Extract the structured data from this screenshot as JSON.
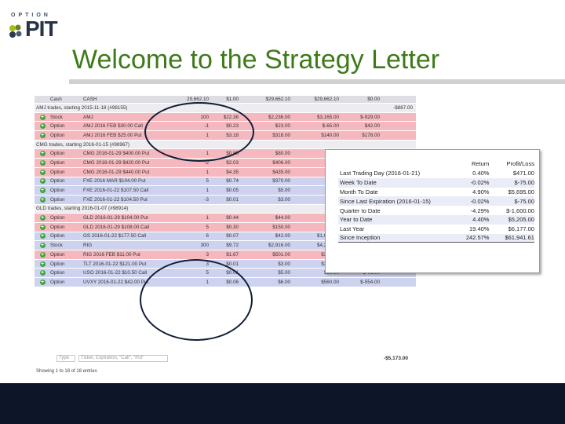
{
  "logo": {
    "top_word": "OPTION",
    "main_word": "PIT"
  },
  "title": "Welcome to the Strategy Letter",
  "positions": {
    "header": {
      "type": "Cash",
      "security": "CASH",
      "qty": "29,662.10",
      "price": "$1.00",
      "cost": "$29,662.10",
      "market": "$29,662.10",
      "pl": "$0.00"
    },
    "rows": [
      {
        "kind": "group",
        "label": "AMJ trades, starting 2015-11-18 (#98155)",
        "pl": "-$887.00",
        "tone": "pos"
      },
      {
        "kind": "pos",
        "type": "Stock",
        "security": "AMJ",
        "qty": "100",
        "price": "$22.36",
        "cost": "$2,236.00",
        "market": "$3,165.00",
        "pl": "$-929.00",
        "tone": "pos"
      },
      {
        "kind": "pos",
        "type": "Option",
        "security": "AMJ 2016 FEB $30.00 Call",
        "qty": "-1",
        "price": "$0.23",
        "cost": "$23.00",
        "market": "$-65.00",
        "pl": "$42.00",
        "tone": "pos"
      },
      {
        "kind": "pos",
        "type": "Option",
        "security": "AMJ 2016 FEB $25.00 Put",
        "qty": "1",
        "price": "$3.18",
        "cost": "$318.00",
        "market": "$140.00",
        "pl": "$178.00",
        "tone": "pos"
      },
      {
        "kind": "group",
        "label": "CMG trades, starting 2016-01-15 (#98967)",
        "pl": "",
        "tone": "neu"
      },
      {
        "kind": "pos",
        "type": "Option",
        "security": "CMG 2016-01-29 $400.00 Put",
        "qty": "1",
        "price": "$0.80",
        "cost": "$80.00",
        "market": "",
        "pl": "",
        "tone": "pos"
      },
      {
        "kind": "pos",
        "type": "Option",
        "security": "CMG 2016-01-29 $420.00 Put",
        "qty": "-2",
        "price": "$2.03",
        "cost": "$406.00",
        "market": "",
        "pl": "",
        "tone": "pos"
      },
      {
        "kind": "pos",
        "type": "Option",
        "security": "CMG 2016-01-29 $440.00 Put",
        "qty": "1",
        "price": "$4.35",
        "cost": "$435.00",
        "market": "",
        "pl": "",
        "tone": "pos"
      },
      {
        "kind": "pos",
        "type": "Option",
        "security": "FXE 2016 MAR $104.00 Put",
        "qty": "5",
        "price": "$0.74",
        "cost": "$370.00",
        "market": "",
        "pl": "",
        "tone": "neg"
      },
      {
        "kind": "pos",
        "type": "Option",
        "security": "FXE 2016-01-22 $107.50 Call",
        "qty": "1",
        "price": "$0.05",
        "cost": "$5.00",
        "market": "",
        "pl": "",
        "tone": "neg"
      },
      {
        "kind": "pos",
        "type": "Option",
        "security": "FXE 2016-01-22 $104.50 Put",
        "qty": "-3",
        "price": "$0.01",
        "cost": "$3.00",
        "market": "",
        "pl": "",
        "tone": "neg"
      },
      {
        "kind": "group",
        "label": "GLD trades, starting 2016-01-07 (#98914)",
        "pl": "",
        "tone": "neu"
      },
      {
        "kind": "pos",
        "type": "Option",
        "security": "GLD 2016-01-29 $104.00 Put",
        "qty": "1",
        "price": "$0.44",
        "cost": "$44.00",
        "market": "",
        "pl": "",
        "tone": "pos"
      },
      {
        "kind": "pos",
        "type": "Option",
        "security": "GLD 2016-01-29 $108.00 Call",
        "qty": "5",
        "price": "$0.30",
        "cost": "$150.00",
        "market": "",
        "pl": "",
        "tone": "pos"
      },
      {
        "kind": "pos",
        "type": "Option",
        "security": "GS 2016-01-22 $177.50 Call",
        "qty": "6",
        "price": "$0.07",
        "cost": "$42.00",
        "market": "$1,638.00",
        "pl": "$-1,596.00",
        "tone": "neg"
      },
      {
        "kind": "pos",
        "type": "Stock",
        "security": "RIG",
        "qty": "300",
        "price": "$9.72",
        "cost": "$2,916.00",
        "market": "$4,200.00",
        "pl": "$-1,284.00",
        "tone": "neg"
      },
      {
        "kind": "pos",
        "type": "Option",
        "security": "RIG 2016 FEB $11.00 Put",
        "qty": "3",
        "price": "$1.67",
        "cost": "$501.00",
        "market": "$390.00",
        "pl": "$111.00",
        "tone": "pos"
      },
      {
        "kind": "pos",
        "type": "Option",
        "security": "TLT 2016-01-22 $121.00 Put",
        "qty": "3",
        "price": "$0.01",
        "cost": "$3.00",
        "market": "$375.00",
        "pl": "$-372.00",
        "tone": "neg"
      },
      {
        "kind": "pos",
        "type": "Option",
        "security": "USO 2016-01-22 $10.50 Call",
        "qty": "5",
        "price": "$0.01",
        "cost": "$5.00",
        "market": "$80.00",
        "pl": "$-75.00",
        "tone": "neg"
      },
      {
        "kind": "pos",
        "type": "Option",
        "security": "UVXY 2016-01-22 $42.00 Put",
        "qty": "1",
        "price": "$0.06",
        "cost": "$6.00",
        "market": "$560.00",
        "pl": "$-554.00",
        "tone": "neg"
      }
    ],
    "filter_type_placeholder": "Type",
    "filter_ticker_placeholder": "Ticker, Expiration, \"Call\", \"Put\"",
    "total": "-$5,173.00",
    "entries_text": "Showing 1 to 18 of 18 entries"
  },
  "returns": {
    "col_return": "Return",
    "col_pl": "Profit/Loss",
    "rows": [
      {
        "label": "Last Trading Day (2016-01-21)",
        "ret": "0.40%",
        "pl": "$471.00"
      },
      {
        "label": "Week To Date",
        "ret": "-0.02%",
        "pl": "$-75.00"
      },
      {
        "label": "Month To Date",
        "ret": "4.90%",
        "pl": "$5,695.00"
      },
      {
        "label": "Since Last Expiration (2016-01-15)",
        "ret": "-0.02%",
        "pl": "$-75.00"
      },
      {
        "label": "Quarter to Date",
        "ret": "-4.29%",
        "pl": "$-1,600.00"
      },
      {
        "label": "Year to Date",
        "ret": "4.40%",
        "pl": "$5,205.00"
      },
      {
        "label": "Last Year",
        "ret": "19.40%",
        "pl": "$6,177.00"
      },
      {
        "label": "Since Inception",
        "ret": "242.57%",
        "pl": "$61,941.61"
      }
    ]
  },
  "colors": {
    "title": "#3e7a1a",
    "positive_row": "#f5b8be",
    "negative_row": "#cdd3ee",
    "bottom_bar": "#0c1628",
    "plus_icon": "#3ea33e"
  }
}
